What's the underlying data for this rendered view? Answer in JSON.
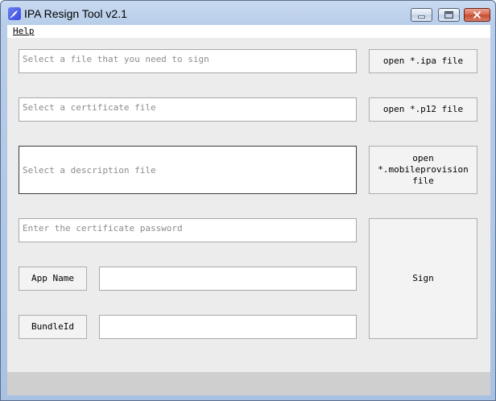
{
  "window": {
    "title": "IPA Resign Tool v2.1",
    "icon": "app-feather-icon",
    "controls": {
      "minimize": "minimize-icon",
      "maximize": "maximize-icon",
      "close": "close-icon"
    }
  },
  "menu": {
    "help": "Help"
  },
  "form": {
    "ipa_placeholder": "Select a file that you need to sign",
    "ipa_button": "open *.ipa file",
    "cert_placeholder": "Select a certificate file",
    "cert_button": "open *.p12 file",
    "desc_placeholder": "Select a description file",
    "desc_button": "open *.mobileprovision file",
    "password_placeholder": "Enter the certificate password",
    "appname_label": "App Name",
    "appname_value": "",
    "bundleid_label": "BundleId",
    "bundleid_value": "",
    "sign_button": "Sign"
  },
  "colors": {
    "client_bg": "#ececec",
    "status_bg": "#cfcfcf",
    "close_btn": "#c44a2e"
  }
}
